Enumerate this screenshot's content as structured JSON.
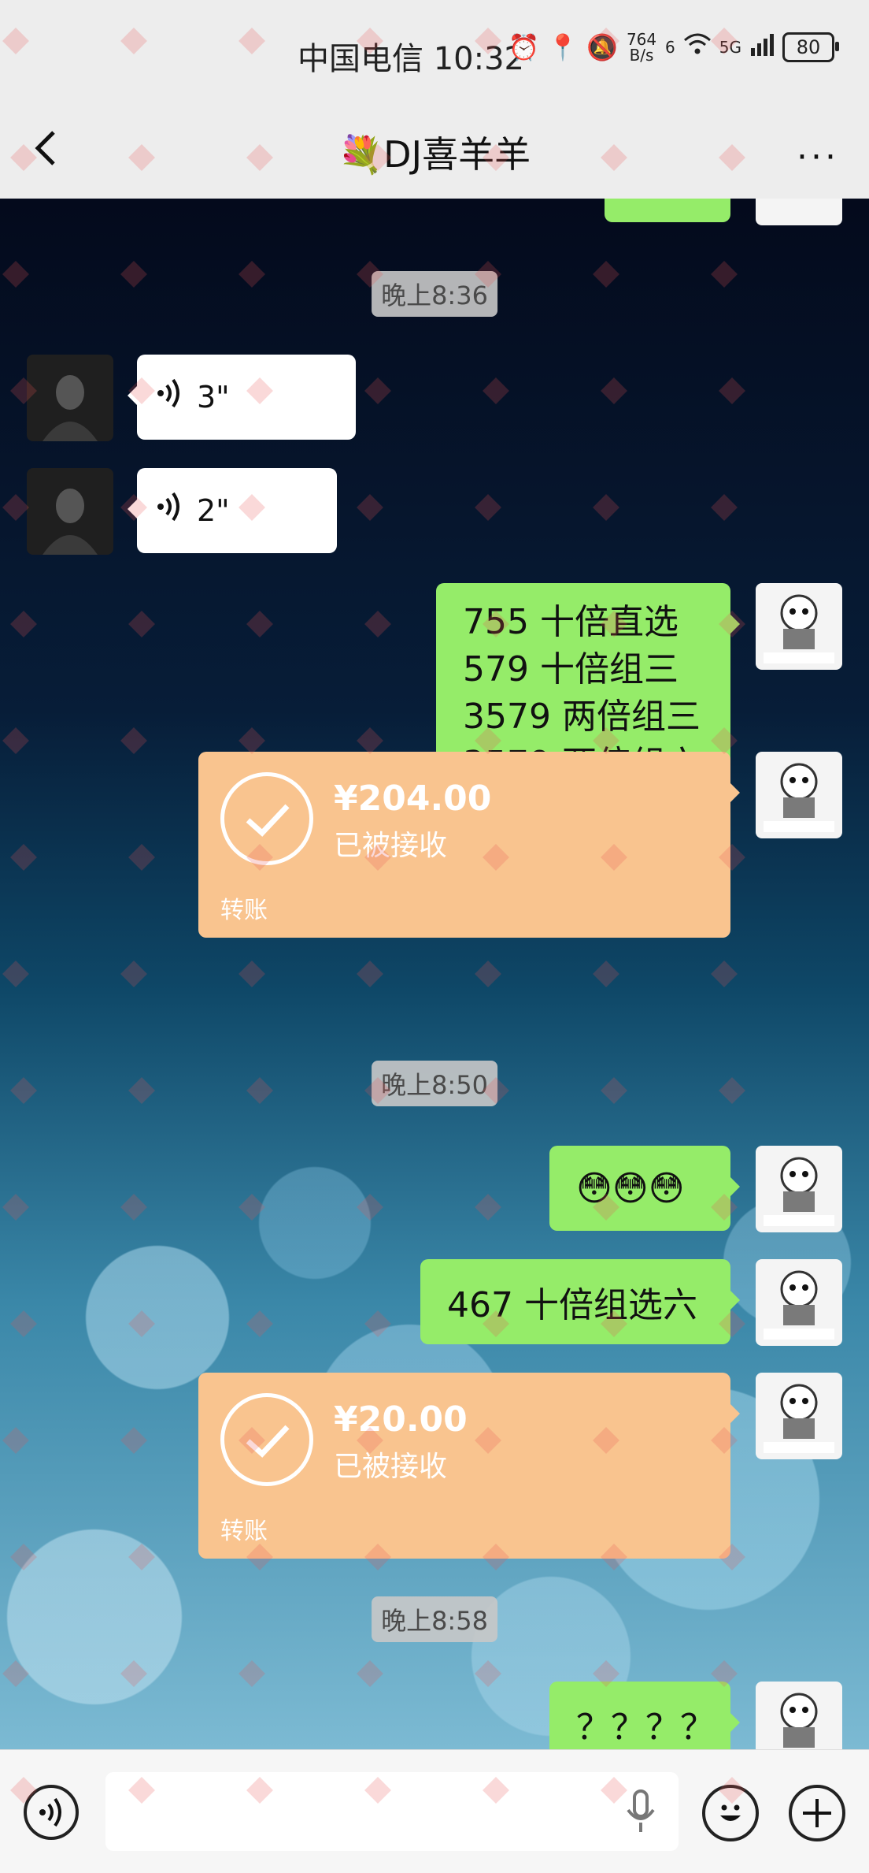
{
  "status_bar": {
    "carrier_time": "中国电信 10:32",
    "net_speed_top": "764",
    "net_speed_bottom": "B/s",
    "signal_label": "6",
    "network": "5G",
    "battery": "80"
  },
  "header": {
    "title": "💐DJ喜羊羊",
    "more": "···"
  },
  "chat": {
    "time1": "晚上8:36",
    "voice1": "3\"",
    "voice2": "2\"",
    "msg_bet1": [
      "755 十倍直选",
      "579 十倍组三",
      "3579 两倍组三",
      "3579 两倍组六"
    ],
    "transfer1": {
      "amount": "¥204.00",
      "status": "已被接收",
      "label": "转账"
    },
    "time2": "晚上8:50",
    "emoji_msg": "😳😳😳",
    "msg_bet2": "467 十倍组选六",
    "transfer2": {
      "amount": "¥20.00",
      "status": "已被接收",
      "label": "转账"
    },
    "time3": "晚上8:58",
    "question_msg": "？？？？"
  },
  "colors": {
    "green_bubble": "#95ec69",
    "transfer_bubble": "#f9c48f",
    "background": "#ededed"
  }
}
